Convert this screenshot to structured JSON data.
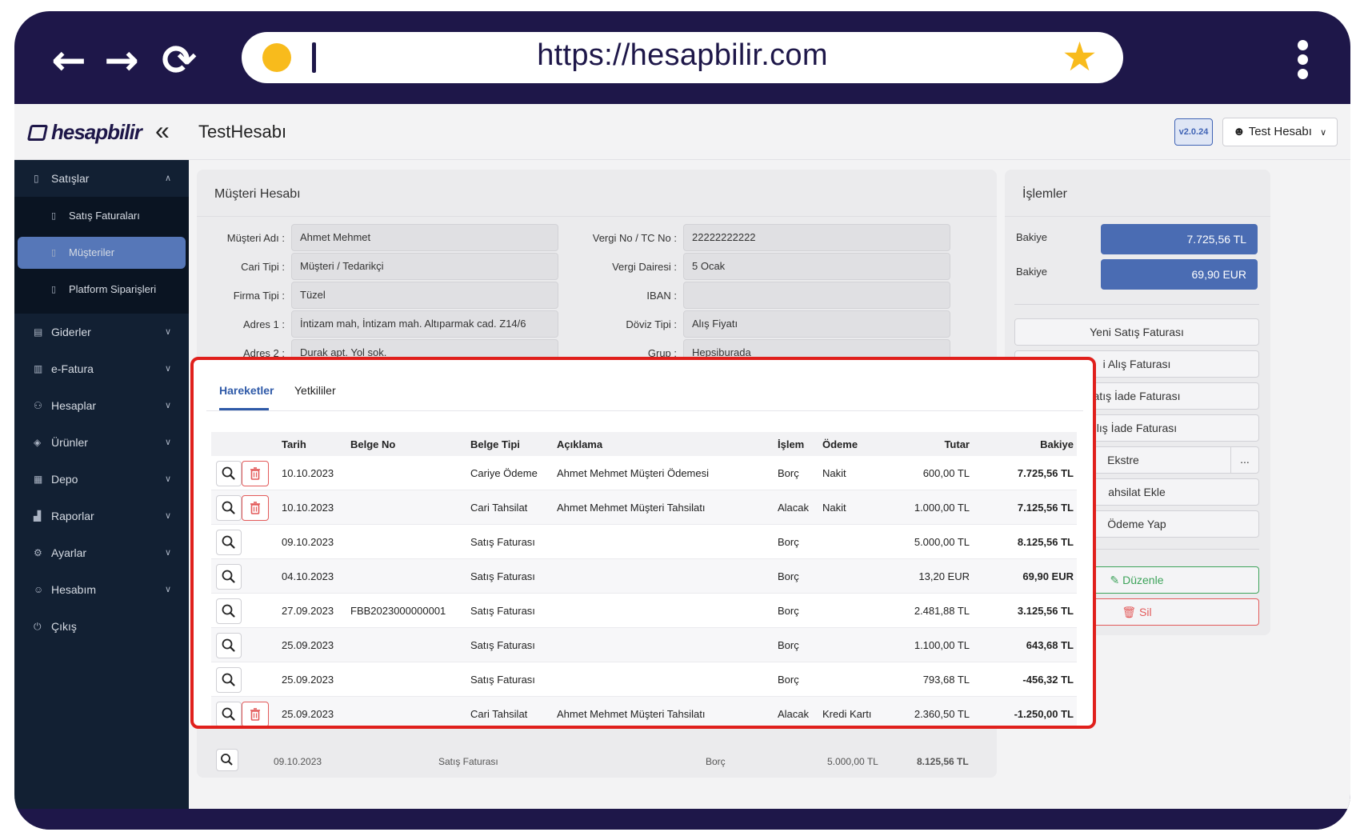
{
  "browser": {
    "url": "https://hesapbilir.com",
    "back_icon": "arrow-left-icon",
    "forward_icon": "arrow-right-icon",
    "reload_icon": "reload-icon",
    "star_icon": "star-icon",
    "menu_icon": "kebab-menu-icon",
    "accent_color": "#f8bb1c",
    "frame_color": "#1e1749"
  },
  "header": {
    "logo": "hesapbilir",
    "title": "TestHesabı",
    "version": "v2.0.24",
    "user": "Test Hesabı"
  },
  "sidebar": {
    "items": [
      {
        "label": "Satışlar",
        "icon": "document-icon"
      },
      {
        "label": "Giderler",
        "icon": "receipt-icon"
      },
      {
        "label": "e-Fatura",
        "icon": "invoice-icon"
      },
      {
        "label": "Hesaplar",
        "icon": "users-icon"
      },
      {
        "label": "Ürünler",
        "icon": "box-icon"
      },
      {
        "label": "Depo",
        "icon": "warehouse-icon"
      },
      {
        "label": "Raporlar",
        "icon": "chart-icon"
      },
      {
        "label": "Ayarlar",
        "icon": "gear-icon"
      },
      {
        "label": "Hesabım",
        "icon": "user-icon"
      },
      {
        "label": "Çıkış",
        "icon": "logout-icon"
      }
    ],
    "subitems": [
      {
        "label": "Satış Faturaları"
      },
      {
        "label": "Müşteriler"
      },
      {
        "label": "Platform Siparişleri"
      }
    ],
    "active_color": "#5677b8"
  },
  "customer": {
    "title": "Müşteri Hesabı",
    "labels": {
      "name": "Müşteri Adı :",
      "cari_type": "Cari Tipi :",
      "firm_type": "Firma Tipi :",
      "address1": "Adres 1 :",
      "address2": "Adres 2 :",
      "tax_no": "Vergi No / TC No :",
      "tax_office": "Vergi Dairesi :",
      "iban": "IBAN :",
      "currency_type": "Döviz Tipi :",
      "group": "Grup :"
    },
    "values": {
      "name": "Ahmet Mehmet",
      "cari_type": "Müşteri / Tedarikçi",
      "firm_type": "Tüzel",
      "address1": "İntizam mah, İntizam mah. Altıparmak cad. Z14/6",
      "address2": "Durak apt. Yol sok.",
      "tax_no": "22222222222",
      "tax_office": "5 Ocak",
      "iban": "",
      "currency_type": "Alış Fiyatı",
      "group": "Hepsiburada"
    },
    "background_row": {
      "date": "09.10.2023",
      "doc_type": "Satış Faturası",
      "operation": "Borç",
      "amount": "5.000,00 TL",
      "balance": "8.125,56 TL"
    }
  },
  "operations": {
    "title": "İşlemler",
    "balance_label": "Bakiye",
    "balances": [
      "7.725,56 TL",
      "69,90 EUR"
    ],
    "balance_color": "#4a6cb3",
    "buttons": [
      "Yeni Satış Faturası",
      "i Alış Faturası",
      "atış İade Faturası",
      "lış İade Faturası",
      "Ekstre",
      "ahsilat Ekle",
      "Ödeme Yap"
    ],
    "more": "...",
    "edit": "Düzenle",
    "delete": "Sil"
  },
  "popup": {
    "border_color": "#e0201c",
    "tabs": [
      {
        "label": "Hareketler"
      },
      {
        "label": "Yetkililer"
      }
    ],
    "columns": {
      "date": "Tarih",
      "doc_no": "Belge No",
      "doc_type": "Belge Tipi",
      "description": "Açıklama",
      "operation": "İşlem",
      "payment": "Ödeme",
      "amount": "Tutar",
      "balance": "Bakiye"
    },
    "rows": [
      {
        "date": "10.10.2023",
        "doc_no": "",
        "doc_type": "Cariye Ödeme",
        "description": "Ahmet Mehmet Müşteri Ödemesi",
        "operation": "Borç",
        "payment": "Nakit",
        "amount": "600,00 TL",
        "balance": "7.725,56 TL",
        "deletable": true
      },
      {
        "date": "10.10.2023",
        "doc_no": "",
        "doc_type": "Cari Tahsilat",
        "description": "Ahmet Mehmet Müşteri Tahsilatı",
        "operation": "Alacak",
        "payment": "Nakit",
        "amount": "1.000,00 TL",
        "balance": "7.125,56 TL",
        "deletable": true
      },
      {
        "date": "09.10.2023",
        "doc_no": "",
        "doc_type": "Satış Faturası",
        "description": "",
        "operation": "Borç",
        "payment": "",
        "amount": "5.000,00 TL",
        "balance": "8.125,56 TL",
        "deletable": false
      },
      {
        "date": "04.10.2023",
        "doc_no": "",
        "doc_type": "Satış Faturası",
        "description": "",
        "operation": "Borç",
        "payment": "",
        "amount": "13,20 EUR",
        "balance": "69,90 EUR",
        "deletable": false
      },
      {
        "date": "27.09.2023",
        "doc_no": "FBB2023000000001",
        "doc_type": "Satış Faturası",
        "description": "",
        "operation": "Borç",
        "payment": "",
        "amount": "2.481,88 TL",
        "balance": "3.125,56 TL",
        "deletable": false
      },
      {
        "date": "25.09.2023",
        "doc_no": "",
        "doc_type": "Satış Faturası",
        "description": "",
        "operation": "Borç",
        "payment": "",
        "amount": "1.100,00 TL",
        "balance": "643,68 TL",
        "deletable": false
      },
      {
        "date": "25.09.2023",
        "doc_no": "",
        "doc_type": "Satış Faturası",
        "description": "",
        "operation": "Borç",
        "payment": "",
        "amount": "793,68 TL",
        "balance": "-456,32 TL",
        "deletable": false
      },
      {
        "date": "25.09.2023",
        "doc_no": "",
        "doc_type": "Cari Tahsilat",
        "description": "Ahmet Mehmet Müşteri Tahsilatı",
        "operation": "Alacak",
        "payment": "Kredi Kartı",
        "amount": "2.360,50 TL",
        "balance": "-1.250,00 TL",
        "deletable": true
      }
    ]
  }
}
